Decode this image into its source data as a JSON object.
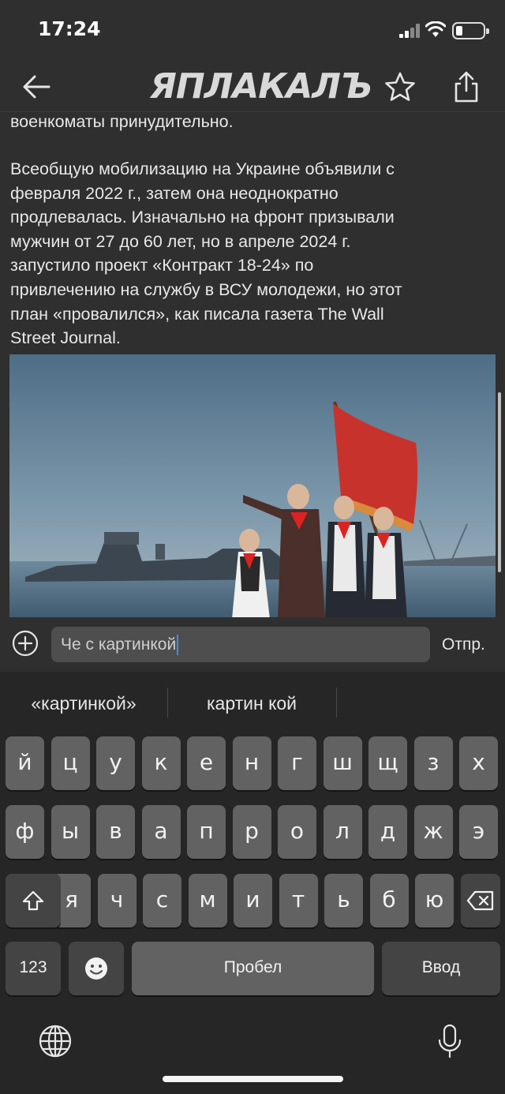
{
  "status": {
    "time": "17:24"
  },
  "nav": {
    "logo": "ЯПЛАКАЛЪ"
  },
  "article": {
    "partial_line": "военкоматы принудительно.",
    "paragraph_lines": [
      "Всеобщую мобилизацию на Украине объявили с",
      "февраля 2022 г., затем она неоднократно",
      "продлевалась. Изначально на фронт призывали",
      "мужчин от 27 до 60 лет, но в апреле 2024 г.",
      "запустило проект «Контракт 18-24» по",
      "привлечению на службу в ВСУ молодежи, но этот",
      "план «провалился», как писала газета The Wall",
      "Street Journal."
    ]
  },
  "composer": {
    "input_value": "Че с картинкой",
    "send_label": "Отпр."
  },
  "keyboard": {
    "suggestions": [
      "«картинкой»",
      "картин кой"
    ],
    "row1": [
      "й",
      "ц",
      "у",
      "к",
      "е",
      "н",
      "г",
      "ш",
      "щ",
      "з",
      "х"
    ],
    "row2": [
      "ф",
      "ы",
      "в",
      "а",
      "п",
      "р",
      "о",
      "л",
      "д",
      "ж",
      "э"
    ],
    "row3": [
      "я",
      "ч",
      "с",
      "м",
      "и",
      "т",
      "ь",
      "б",
      "ю"
    ],
    "numbers_label": "123",
    "space_label": "Пробел",
    "return_label": "Ввод"
  },
  "colors": {
    "background": "#2f2f2f",
    "keyboard_bg": "#262626",
    "key": "#626262",
    "caret": "#3a8ff7",
    "flag_red": "#c8322c"
  }
}
